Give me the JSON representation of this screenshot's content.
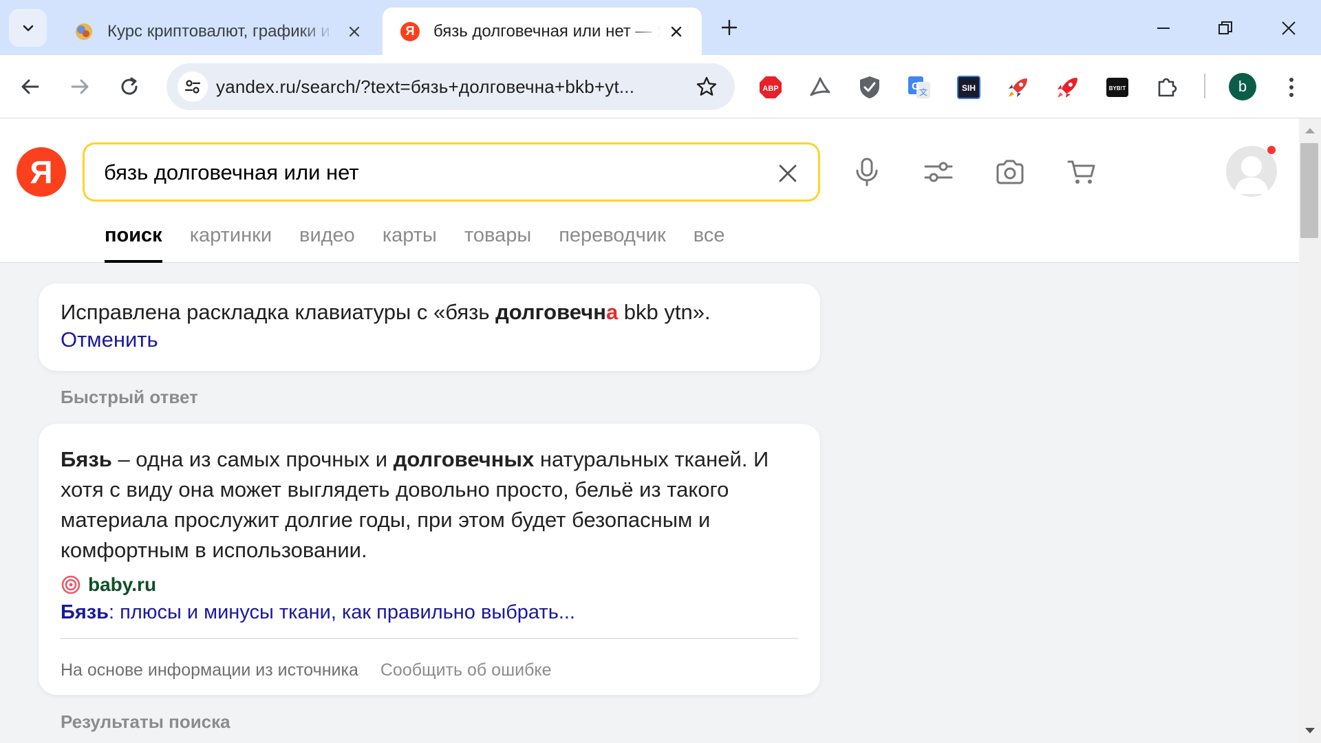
{
  "browser": {
    "tabs": [
      {
        "title": "Курс криптовалют, графики и",
        "active": false
      },
      {
        "title": "бязь долговечная или нет — Я",
        "active": true
      }
    ],
    "url": "yandex.ru/search/?text=бязь+долговечна+bkb+yt...",
    "profile_initial": "b",
    "extensions": [
      "adblock-plus-icon",
      "acrobat-icon",
      "shield-icon",
      "translate-icon",
      "sih-icon",
      "rocket-icon",
      "rocket-red-icon",
      "bybit-icon",
      "puzzle-icon"
    ],
    "ext_labels": {
      "abp": "ABP",
      "sih": "SIH",
      "bybit": "BYB!T"
    }
  },
  "yandex": {
    "logo_letter": "Я",
    "query": "бязь долговечная или нет",
    "tabs": [
      "поиск",
      "картинки",
      "видео",
      "карты",
      "товары",
      "переводчик",
      "все"
    ],
    "active_tab": "поиск"
  },
  "spell_fix": {
    "prefix": "Исправлена раскладка клавиатуры с «бязь ",
    "bold": "долговечн",
    "red": "а",
    "suffix": " bkb ytn».",
    "undo": "Отменить"
  },
  "quick_answer": {
    "section_title": "Быстрый ответ",
    "term1": "Бязь",
    "text1": " – одна из самых прочных и ",
    "term2": "долговечных",
    "text2": " натуральных тканей. И хотя с виду она может выглядеть довольно просто, бельё из такого материала прослужит долгие годы, при этом будет безопасным и комфортным в использовании.",
    "source_name": "baby.ru",
    "link_bold": "Бязь",
    "link_rest": ": плюсы и минусы ткани, как правильно выбрать...",
    "footer_info": "На основе информации из источника",
    "footer_report": "Сообщить об ошибке"
  },
  "results": {
    "section_title": "Результаты поиска"
  },
  "colors": {
    "yandex_red": "#fc3f1d",
    "search_border": "#fed42b",
    "link": "#1a1a9c",
    "source_green": "#0e5028"
  }
}
